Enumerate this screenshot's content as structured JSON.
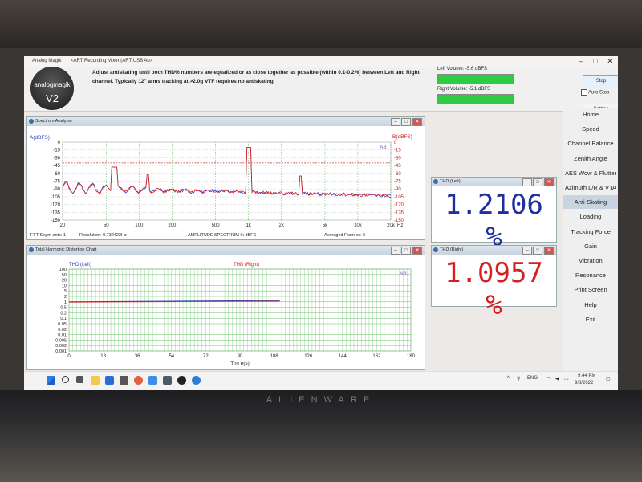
{
  "window": {
    "title": "Analog Magik",
    "subtitle": "<ART Recording Mixer (ART USB Au>"
  },
  "logo": {
    "line1": "analogmagik",
    "line2": "V2"
  },
  "instructions": {
    "line1": "Adjust antiskating  until both THD% numbers are equalized or as close together as possible (within 0.1-0.2%) between Left and Right",
    "line2": "channel.   Typically 12\" arms tracking at >2.0g VTF requires no antiskating."
  },
  "volume": {
    "left_label": "Left Volume:   -5.6  dBFS",
    "right_label": "Right Volume:  -5.1  dBFS",
    "bar_color": "#2ecc40"
  },
  "controls": {
    "stop": "Stop",
    "auto_stop": "Auto Stop",
    "setting": "Setting"
  },
  "nav": {
    "items": [
      "Home",
      "Speed",
      "Channel Balance",
      "Zenith Angle",
      "AES Wow & Flutter",
      "Azimuth L/R & VTA",
      "Anti-Skating",
      "Loading",
      "Tracking Force",
      "Gain",
      "Vibration",
      "Resonance",
      "Print Screen",
      "Help",
      "Exit"
    ],
    "active": "Anti-Skating"
  },
  "spectrum": {
    "title": "Spectrum Analyzer",
    "ylabel_left": "A(dBFS)",
    "ylabel_right": "B(dBFS)",
    "legend": "AB",
    "y_ticks": [
      "0",
      "-15",
      "-30",
      "-45",
      "-60",
      "-75",
      "-90",
      "-105",
      "-120",
      "-135",
      "-150"
    ],
    "x_ticks": [
      "20",
      "50",
      "100",
      "200",
      "500",
      "1k",
      "2k",
      "5k",
      "10k",
      "20k"
    ],
    "x_unit": "Hz",
    "footer_left": "FFT Segm ents: 1",
    "footer_res": "Resolution: 0.732422Hz",
    "footer_center": "AMPLITUDE SPECTRUM In dBFS",
    "footer_right": "Averaged Fram es:  5"
  },
  "thd_chart": {
    "title": "Total Harmonic Distortion Chart",
    "legend_left": "THD (Left)",
    "legend_right": "THD (Right)",
    "legend_ab": "AB",
    "y_ticks": [
      "100",
      "50",
      "20",
      "10",
      "5",
      "2",
      "1",
      "0.5",
      "0.2",
      "0.1",
      "0.05",
      "0.02",
      "0.01",
      "0.005",
      "0.002",
      "0.001"
    ],
    "x_ticks": [
      "0",
      "18",
      "36",
      "54",
      "72",
      "90",
      "108",
      "126",
      "144",
      "162",
      "180"
    ],
    "xlabel": "Tim e(s)"
  },
  "thd_left": {
    "title": "THD (Left)",
    "value": "1.2106",
    "unit": "%",
    "color": "#1f2f9f"
  },
  "thd_right": {
    "title": "THD (Right)",
    "value": "1.0957",
    "unit": "%",
    "color": "#d42020"
  },
  "taskbar": {
    "lang": "ENG",
    "time": "9:44 PM",
    "date": "9/8/2022"
  },
  "colors": {
    "left_trace": "#3040c0",
    "right_trace": "#e02020",
    "grid": "#2eaa2e"
  }
}
